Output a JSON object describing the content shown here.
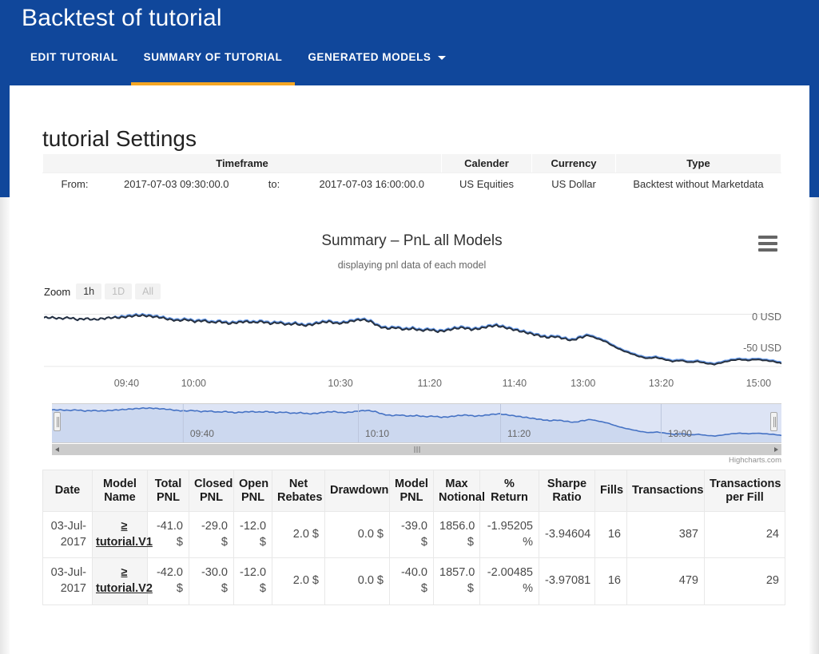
{
  "header": {
    "title": "Backtest of tutorial",
    "tabs": [
      {
        "label": "EDIT TUTORIAL",
        "active": false
      },
      {
        "label": "SUMMARY OF TUTORIAL",
        "active": true
      },
      {
        "label": "GENERATED MODELS",
        "active": false,
        "dropdown": true
      }
    ],
    "accent_color": "#f5a623",
    "bar_color": "#10479b"
  },
  "settings": {
    "title": "tutorial Settings",
    "columns": [
      "Timeframe",
      "Calender",
      "Currency",
      "Type"
    ],
    "from_label": "From:",
    "from_value": "2017-07-03 09:30:00.0",
    "to_label": "to:",
    "to_value": "2017-07-03 16:00:00.0",
    "calendar": "US Equities",
    "currency": "US Dollar",
    "type": "Backtest without Marketdata"
  },
  "chart": {
    "title": "Summary – PnL all Models",
    "subtitle": "displaying pnl data of each model",
    "menu_icon": "hamburger-menu-icon",
    "zoom_label": "Zoom",
    "zoom_buttons": [
      {
        "label": "1h",
        "active": true
      },
      {
        "label": "1D",
        "active": false
      },
      {
        "label": "All",
        "active": false
      }
    ],
    "credit": "Highcharts.com"
  },
  "chart_data": {
    "type": "line",
    "title": "Summary – PnL all Models",
    "subtitle": "displaying pnl data of each model",
    "xlabel": "",
    "ylabel": "USD",
    "ylim": [
      -60,
      5
    ],
    "ytick_labels": [
      "0 USD",
      "-50 USD"
    ],
    "yticks": [
      0,
      -50
    ],
    "grid": true,
    "legend": "none",
    "xtick_labels": [
      "09:40",
      "10:00",
      "10:30",
      "11:20",
      "11:40",
      "13:00",
      "13:20",
      "15:00"
    ],
    "navigator_xtick_labels": [
      "09:40",
      "10:10",
      "11:20",
      "13:00"
    ],
    "series": [
      {
        "name": "tutorial.V1",
        "color": "#6699e8",
        "values": [
          -2,
          -2,
          -3,
          -2,
          -4,
          -3,
          -4,
          -3,
          -2,
          -1,
          0,
          1,
          1,
          0,
          -1,
          -3,
          -4,
          -3,
          -5,
          -4,
          -6,
          -5,
          -7,
          -6,
          -5,
          -6,
          -5,
          -7,
          -6,
          -8,
          -7,
          -9,
          -8,
          -6,
          -5,
          -7,
          -6,
          -4,
          -3,
          -5,
          -10,
          -12,
          -11,
          -13,
          -12,
          -14,
          -13,
          -15,
          -14,
          -12,
          -11,
          -13,
          -12,
          -10,
          -9,
          -11,
          -13,
          -15,
          -17,
          -19,
          -21,
          -20,
          -22,
          -24,
          -21,
          -19,
          -22,
          -25,
          -30,
          -34,
          -37,
          -40,
          -42,
          -41,
          -43,
          -45,
          -44,
          -46,
          -45,
          -47,
          -48,
          -46,
          -44,
          -43,
          -44,
          -43,
          -44,
          -45,
          -47
        ]
      },
      {
        "name": "tutorial.V2",
        "color": "#26303f",
        "values": [
          -2,
          -2,
          -3,
          -2,
          -4,
          -3,
          -4,
          -3,
          -2,
          -2,
          -1,
          0,
          0,
          -1,
          -2,
          -4,
          -5,
          -4,
          -6,
          -5,
          -7,
          -6,
          -8,
          -7,
          -6,
          -7,
          -6,
          -8,
          -7,
          -9,
          -8,
          -10,
          -9,
          -7,
          -6,
          -8,
          -7,
          -5,
          -4,
          -6,
          -11,
          -13,
          -12,
          -14,
          -13,
          -15,
          -14,
          -16,
          -15,
          -13,
          -12,
          -14,
          -13,
          -11,
          -10,
          -12,
          -14,
          -16,
          -18,
          -20,
          -22,
          -21,
          -23,
          -25,
          -22,
          -20,
          -23,
          -26,
          -31,
          -35,
          -38,
          -41,
          -43,
          -42,
          -44,
          -46,
          -45,
          -47,
          -46,
          -48,
          -49,
          -47,
          -45,
          -44,
          -45,
          -44,
          -45,
          -46,
          -48
        ]
      }
    ]
  },
  "table": {
    "headers": [
      "Date",
      "Model Name",
      "Total PNL",
      "Closed PNL",
      "Open PNL",
      "Net Rebates",
      "Drawdown",
      "Model PNL",
      "Max Notional",
      "% Return",
      "Sharpe Ratio",
      "Fills",
      "Transactions",
      "Transactions per Fill"
    ],
    "rows": [
      {
        "date": "03-Jul-2017",
        "model_prefix": "≥",
        "model_name": "tutorial.V1",
        "total_pnl": "-41.0 $",
        "closed_pnl": "-29.0 $",
        "open_pnl": "-12.0 $",
        "net_rebates": "2.0 $",
        "drawdown": "0.0 $",
        "model_pnl": "-39.0 $",
        "max_notional": "1856.0 $",
        "pct_return": "-1.95205 %",
        "sharpe_ratio": "-3.94604",
        "fills": "16",
        "transactions": "387",
        "transactions_per_fill": "24"
      },
      {
        "date": "03-Jul-2017",
        "model_prefix": "≥",
        "model_name": "tutorial.V2",
        "total_pnl": "-42.0 $",
        "closed_pnl": "-30.0 $",
        "open_pnl": "-12.0 $",
        "net_rebates": "2.0 $",
        "drawdown": "0.0 $",
        "model_pnl": "-40.0 $",
        "max_notional": "1857.0 $",
        "pct_return": "-2.00485 %",
        "sharpe_ratio": "-3.97081",
        "fills": "16",
        "transactions": "479",
        "transactions_per_fill": "29"
      }
    ]
  }
}
